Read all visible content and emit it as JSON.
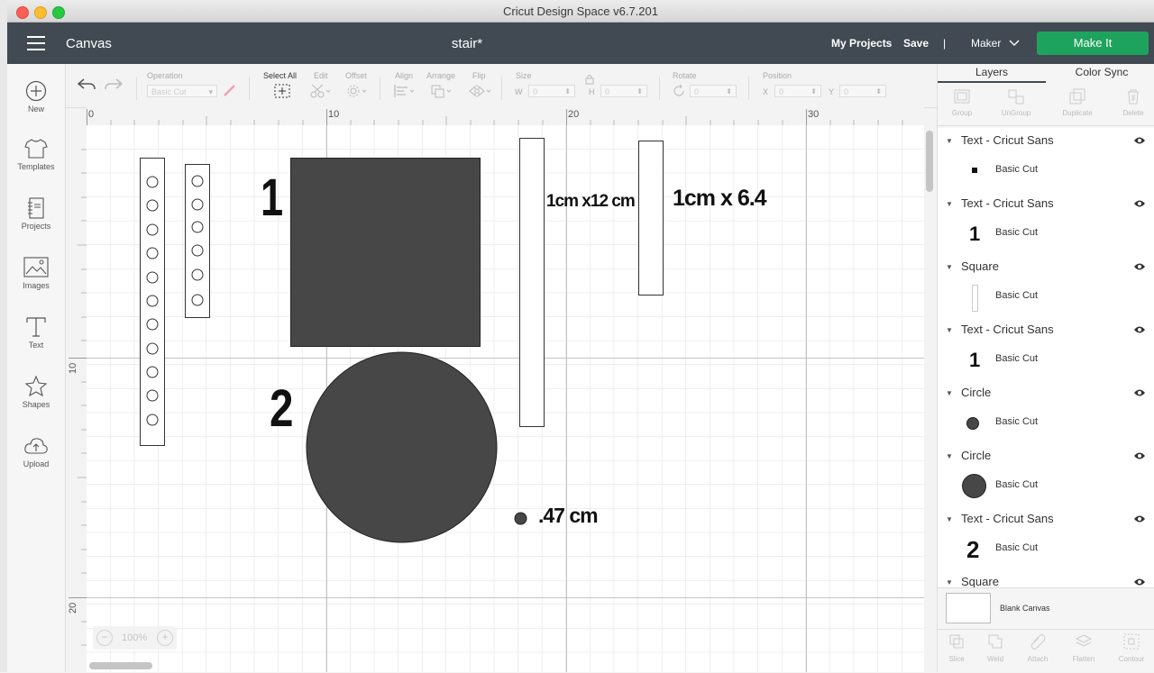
{
  "window": {
    "title": "Cricut Design Space  v6.7.201"
  },
  "header": {
    "section": "Canvas",
    "project_name": "stair*",
    "my_projects": "My Projects",
    "save": "Save",
    "separator": "|",
    "machine": "Maker",
    "make_it": "Make It"
  },
  "sidebar": {
    "items": [
      {
        "label": "New",
        "icon": "plus-circle-icon"
      },
      {
        "label": "Templates",
        "icon": "shirt-icon"
      },
      {
        "label": "Projects",
        "icon": "notebook-icon"
      },
      {
        "label": "Images",
        "icon": "image-icon"
      },
      {
        "label": "Text",
        "icon": "text-icon"
      },
      {
        "label": "Shapes",
        "icon": "shapes-icon"
      },
      {
        "label": "Upload",
        "icon": "cloud-upload-icon"
      }
    ]
  },
  "toolbar": {
    "operation_label": "Operation",
    "operation_value": "Basic Cut",
    "select_all": "Select All",
    "edit": "Edit",
    "offset": "Offset",
    "align": "Align",
    "arrange": "Arrange",
    "flip": "Flip",
    "size": "Size",
    "w": "W",
    "h": "H",
    "size_w": "0",
    "size_h": "0",
    "rotate": "Rotate",
    "rotate_value": "0",
    "position": "Position",
    "x": "X",
    "y": "Y",
    "pos_x": "0",
    "pos_y": "0"
  },
  "rulers": {
    "top": [
      "0",
      "10",
      "20",
      "30"
    ],
    "left": [
      "10",
      "20"
    ]
  },
  "canvas": {
    "label_1": "1",
    "label_2": "2",
    "text_12cm": "1cm x12 cm",
    "text_64": "1cm x 6.4",
    "text_047": ".47 cm",
    "fill": "#474747"
  },
  "zoom": {
    "level": "100%",
    "minus": "−",
    "plus": "+"
  },
  "panel": {
    "tabs": [
      "Layers",
      "Color Sync"
    ],
    "actions": [
      "Group",
      "UnGroup",
      "Duplicate",
      "Delete"
    ],
    "layers": [
      {
        "name": "Text - Cricut Sans",
        "op": "Basic Cut",
        "thumb": "small-square"
      },
      {
        "name": "Text - Cricut Sans",
        "op": "Basic Cut",
        "thumb": "one",
        "glyph": "1"
      },
      {
        "name": "Square",
        "op": "Basic Cut",
        "thumb": "thin-rect"
      },
      {
        "name": "Text - Cricut Sans",
        "op": "Basic Cut",
        "thumb": "one",
        "glyph": "1"
      },
      {
        "name": "Circle",
        "op": "Basic Cut",
        "thumb": "small-circle"
      },
      {
        "name": "Circle",
        "op": "Basic Cut",
        "thumb": "big-circle"
      },
      {
        "name": "Text - Cricut Sans",
        "op": "Basic Cut",
        "thumb": "two",
        "glyph": "2"
      },
      {
        "name": "Square",
        "op": "",
        "thumb": "none"
      }
    ],
    "blank_canvas": "Blank Canvas",
    "bottom_actions": [
      "Slice",
      "Weld",
      "Attach",
      "Flatten",
      "Contour"
    ]
  }
}
